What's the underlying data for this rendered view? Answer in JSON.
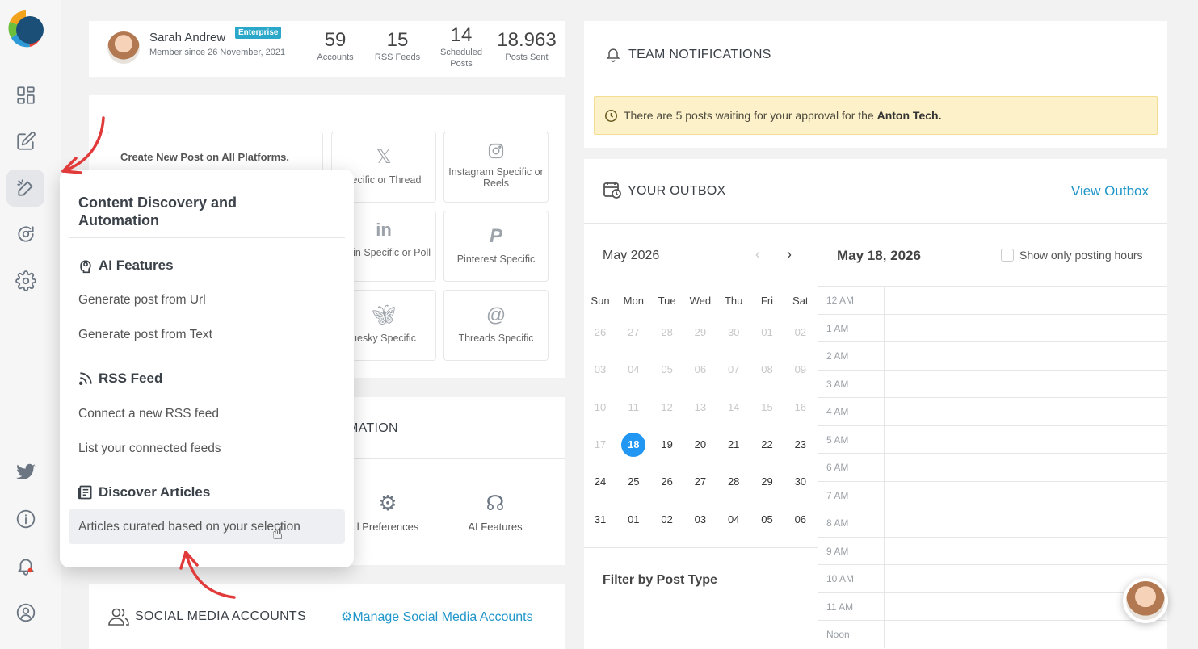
{
  "profile": {
    "name": "Sarah Andrew",
    "plan_badge": "Enterprise",
    "member_since": "Member since 26 November, 2021",
    "stats": [
      {
        "value": "59",
        "label": "Accounts"
      },
      {
        "value": "15",
        "label": "RSS Feeds"
      },
      {
        "value": "14",
        "label": "Scheduled Posts"
      },
      {
        "value": "18.963",
        "label": "Posts Sent"
      }
    ]
  },
  "create_post": {
    "all_platforms": "Create New Post on All Platforms.",
    "platforms": [
      {
        "label": "pecific or Thread",
        "icon": "x-icon"
      },
      {
        "label": "Instagram Specific or Reels",
        "icon": "instagram-icon"
      },
      {
        "label": "kedin Specific or Poll",
        "icon": "linkedin-icon"
      },
      {
        "label": "Pinterest Specific",
        "icon": "pinterest-icon"
      },
      {
        "label": "uesky Specific",
        "icon": "bluesky-icon"
      },
      {
        "label": "Threads Specific",
        "icon": "threads-icon"
      }
    ]
  },
  "automation": {
    "title_fragment": "MATION",
    "items": [
      {
        "label": "l Preferences",
        "icon": "gears-icon"
      },
      {
        "label": "AI Features",
        "icon": "ai-brain-icon"
      }
    ]
  },
  "social": {
    "title": "SOCIAL MEDIA ACCOUNTS",
    "manage_link": "Manage Social Media Accounts"
  },
  "notifications": {
    "title": "TEAM NOTIFICATIONS",
    "alert_text": "There are 5 posts waiting for your approval for the",
    "alert_bold": "Anton Tech."
  },
  "outbox": {
    "title": "YOUR OUTBOX",
    "view_link": "View Outbox",
    "month": "May 2026",
    "selected_date": "May 18, 2026",
    "posting_hours_label": "Show only posting hours",
    "weekdays": [
      "Sun",
      "Mon",
      "Tue",
      "Wed",
      "Thu",
      "Fri",
      "Sat"
    ],
    "weeks": [
      [
        "26",
        "27",
        "28",
        "29",
        "30",
        "01",
        "02"
      ],
      [
        "03",
        "04",
        "05",
        "06",
        "07",
        "08",
        "09"
      ],
      [
        "10",
        "11",
        "12",
        "13",
        "14",
        "15",
        "16"
      ],
      [
        "17",
        "18",
        "19",
        "20",
        "21",
        "22",
        "23"
      ],
      [
        "24",
        "25",
        "26",
        "27",
        "28",
        "29",
        "30"
      ],
      [
        "31",
        "01",
        "02",
        "03",
        "04",
        "05",
        "06"
      ]
    ],
    "filter_title": "Filter by Post Type",
    "hours": [
      "12 AM",
      "1 AM",
      "2 AM",
      "3 AM",
      "4 AM",
      "5 AM",
      "6 AM",
      "7 AM",
      "8 AM",
      "9 AM",
      "10 AM",
      "11 AM",
      "Noon"
    ]
  },
  "popup": {
    "title": "Content Discovery and Automation",
    "sections": [
      {
        "title": "AI Features",
        "icon": "ai-brain-icon",
        "items": [
          "Generate post from Url",
          "Generate post from Text"
        ]
      },
      {
        "title": "RSS Feed",
        "icon": "rss-icon",
        "items": [
          "Connect a new RSS feed",
          "List your connected feeds"
        ]
      },
      {
        "title": "Discover Articles",
        "icon": "newspaper-icon",
        "items": [
          "Articles curated based on your selection"
        ]
      }
    ]
  },
  "colors": {
    "accent": "#2196f3",
    "link": "#2196c9",
    "badge": "#2aa7c9",
    "alert_bg": "#fdf1c9",
    "annotation_arrow": "#e03a3a"
  }
}
